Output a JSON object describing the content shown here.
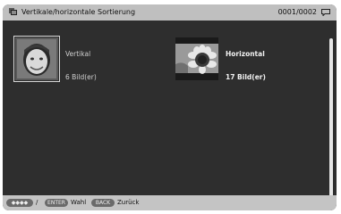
{
  "header": {
    "title": "Vertikale/horizontale Sortierung",
    "counter": "0001/0002"
  },
  "items": [
    {
      "label": "Vertikal",
      "count": "6 Bild(er)",
      "thumbnail": "portrait-child"
    },
    {
      "label": "Horizontal",
      "count": "17 Bild(er)",
      "thumbnail": "sunflower"
    }
  ],
  "footer": {
    "nav_symbol": "◆◆◆◆",
    "separator": "/",
    "enter_key": "ENTER",
    "enter_label": "Wahl",
    "back_key": "BACK",
    "back_label": "Zurück"
  }
}
